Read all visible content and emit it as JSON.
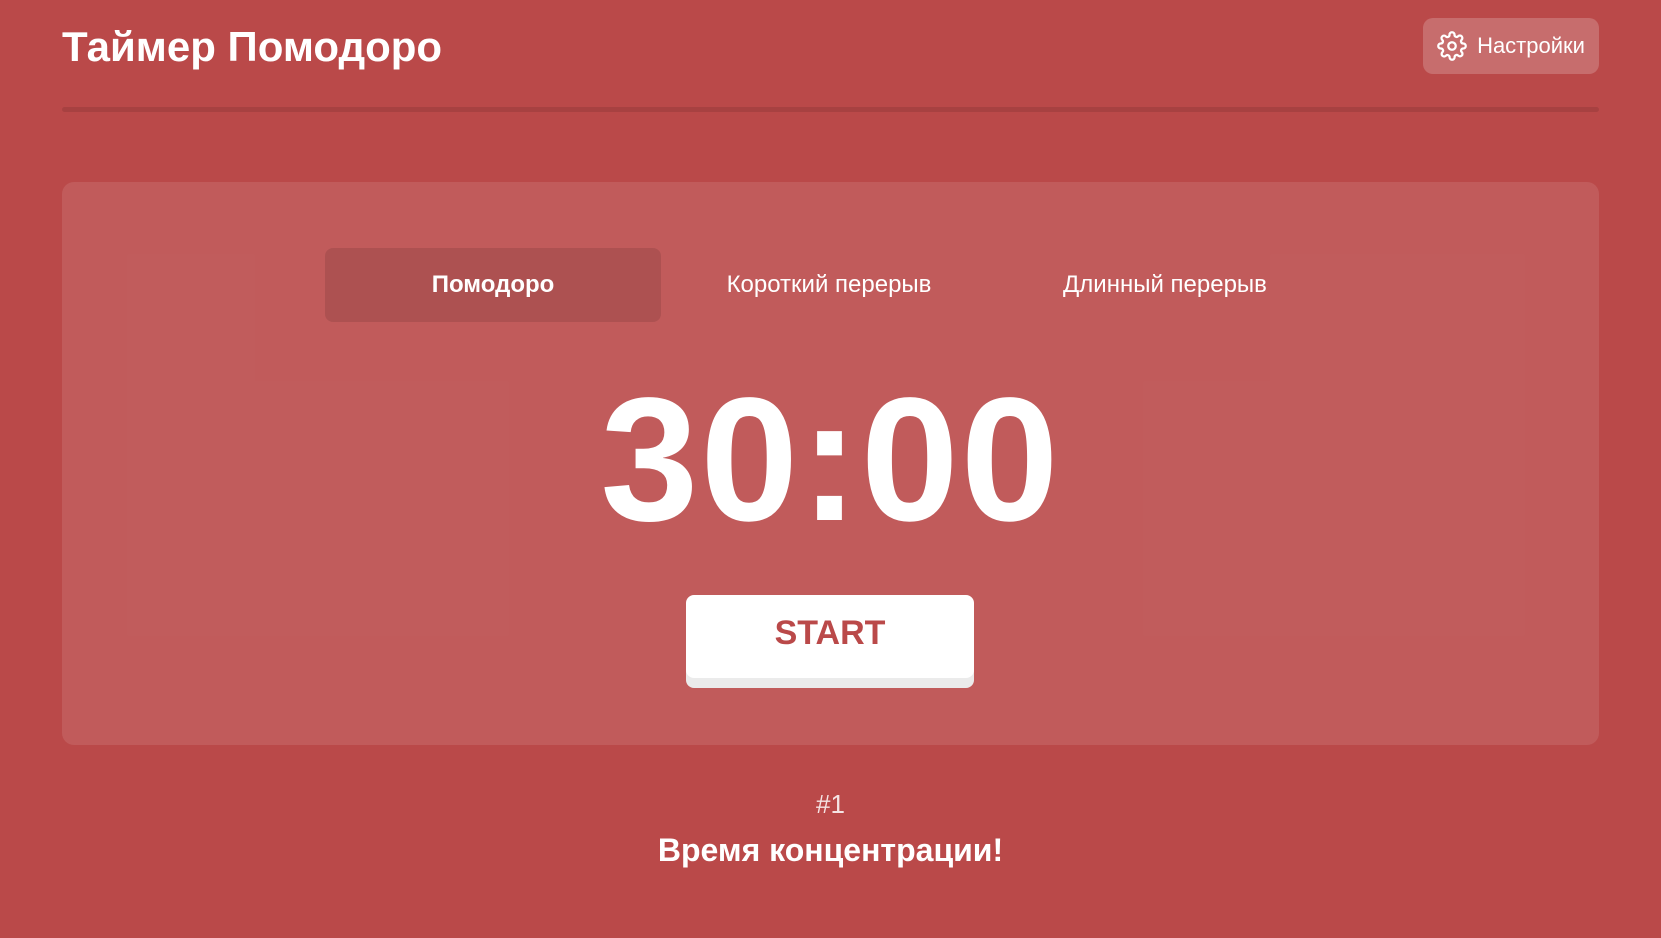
{
  "header": {
    "title": "Таймер Помодоро",
    "settings_label": "Настройки",
    "settings_icon": "gear-icon"
  },
  "timer": {
    "tabs": [
      {
        "label": "Помодоро",
        "active": true
      },
      {
        "label": "Короткий перерыв",
        "active": false
      },
      {
        "label": "Длинный перерыв",
        "active": false
      }
    ],
    "time": "30:00",
    "start_label": "START"
  },
  "session": {
    "count": "#1",
    "message": "Время концентрации!"
  },
  "colors": {
    "background": "#ba4949",
    "accent": "#ffffff",
    "button_text": "#ba4949"
  }
}
